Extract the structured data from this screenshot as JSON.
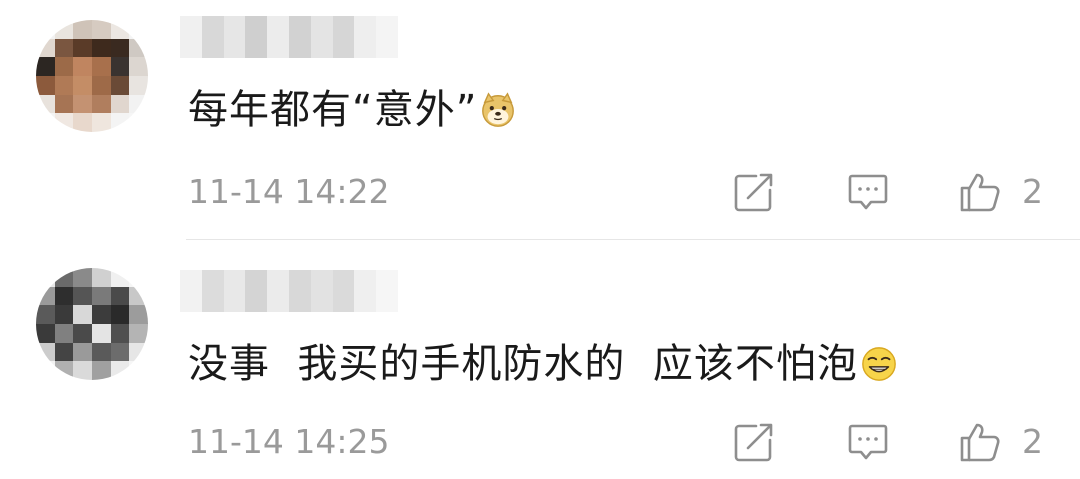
{
  "comments": [
    {
      "text": "每年都有“意外”",
      "emoji": "doge-emoji",
      "time": "11-14 14:22",
      "likes": "2",
      "icons": {
        "repost": "repost-icon",
        "comment": "comment-icon",
        "like": "thumbs-up-icon"
      }
    },
    {
      "text": "没事  我买的手机防水的  应该不怕泡",
      "emoji": "smirk-emoji",
      "time": "11-14 14:25",
      "likes": "2",
      "icons": {
        "repost": "repost-icon",
        "comment": "comment-icon",
        "like": "thumbs-up-icon"
      }
    }
  ],
  "colors": {
    "text": "#1a1a1a",
    "meta": "#9a9a9a",
    "icon": "#8e8e8e",
    "divider": "#e6e6e6"
  }
}
